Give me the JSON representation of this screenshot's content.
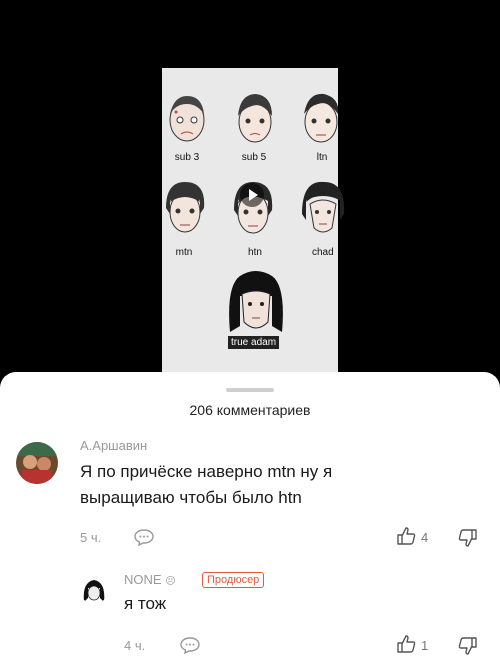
{
  "video": {
    "labels": [
      "sub 3",
      "sub 5",
      "ltn",
      "mtn",
      "htn",
      "chad",
      "true adam"
    ]
  },
  "comments": {
    "count_label": "206 комментариев",
    "items": [
      {
        "author": "А.Аршавин",
        "text_line1": "Я по причёске наверно mtn ну я",
        "text_line2": "выращиваю чтобы было htn",
        "time": "5 ч.",
        "likes": "4"
      }
    ],
    "reply": {
      "author": "NONE",
      "author_emoji": "😐",
      "badge": "Продюсер",
      "text": "я тож",
      "time": "4 ч.",
      "likes": "1"
    }
  },
  "colors": {
    "badge": "#e25a3c",
    "muted": "#999999"
  }
}
